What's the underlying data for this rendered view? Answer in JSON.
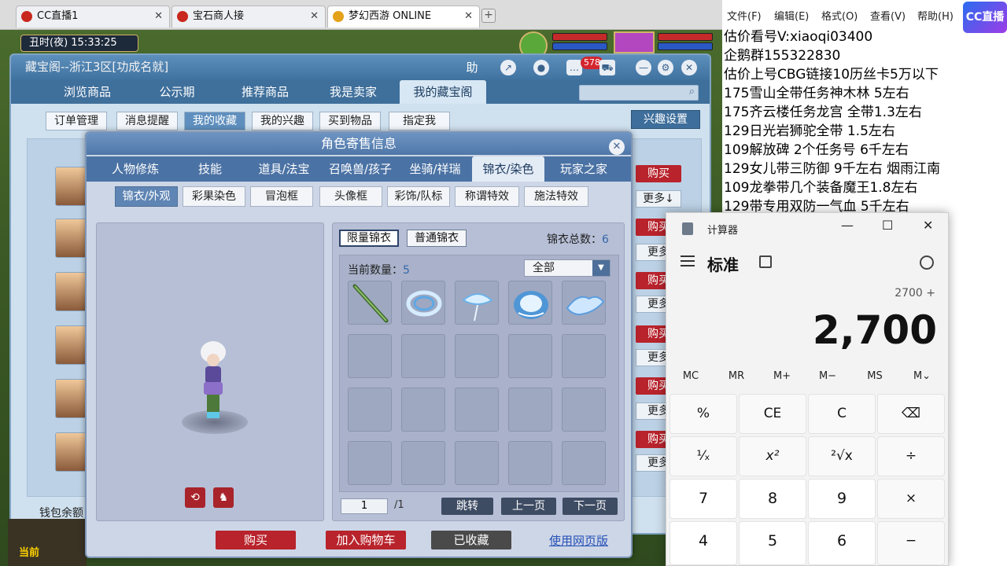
{
  "browser": {
    "tabs": [
      {
        "label": "CC直播1",
        "close": "✕"
      },
      {
        "label": "宝石商人接",
        "close": "✕"
      },
      {
        "label": "梦幻西游 ONLINE",
        "close": "✕"
      }
    ],
    "new_tab": "+"
  },
  "game_hud": {
    "time": "丑时(夜)  15:33:25",
    "bottom_label": "当前"
  },
  "cbg": {
    "title": "藏宝阁--浙江3区[功成名就]",
    "title_icons": {
      "help": "助",
      "badge": "578"
    },
    "nav": [
      "浏览商品",
      "公示期",
      "推荐商品",
      "我是卖家",
      "我的藏宝阁"
    ],
    "subnav": [
      "订单管理",
      "消息提醒",
      "我的收藏",
      "我的兴趣",
      "买到物品",
      "指定我"
    ],
    "interest_settings": "兴趣设置",
    "row_buy": "购买",
    "row_more": "更多",
    "row_more_arrow": "更多↓",
    "wallet": "钱包余额"
  },
  "dialog": {
    "title": "角色寄售信息",
    "close": "✕",
    "tabs": [
      "人物修炼",
      "技能",
      "道具/法宝",
      "召唤兽/孩子",
      "坐骑/祥瑞",
      "锦衣/染色",
      "玩家之家"
    ],
    "subtabs": [
      "锦衣/外观",
      "彩果染色",
      "冒泡框",
      "头像框",
      "彩饰/队标",
      "称谓特效",
      "施法特效"
    ],
    "wardrobe": {
      "tab_limited": "限量锦衣",
      "tab_normal": "普通锦衣",
      "total_label": "锦衣总数：",
      "total_value": "6",
      "current_label": "当前数量：",
      "current_value": "5",
      "filter": "全部",
      "page_current": "1",
      "page_total": "/1",
      "jump": "跳转",
      "prev": "上一页",
      "next": "下一页",
      "item_icons": [
        "staff-item-icon",
        "wave-ring-item-icon",
        "water-fan-item-icon",
        "water-shell-item-icon",
        "ice-wing-item-icon"
      ]
    },
    "preview_icons": {
      "rotate": "⟲",
      "pose": "♞"
    },
    "buttons": {
      "buy": "购买",
      "add_cart": "加入购物车",
      "favorited": "已收藏",
      "web": "使用网页版"
    }
  },
  "notepad": {
    "menu": [
      "文件(F)",
      "编辑(E)",
      "格式(O)",
      "查看(V)",
      "帮助(H)"
    ],
    "logo": "CC直播",
    "lines": [
      "估价看号V:xiaoqi03400",
      "企鹅群155322830",
      "估价上号CBG链接10历丝卡5万以下",
      "175雪山全带任务神木林 5左右",
      "175齐云楼任务龙宫  全带1.3左右",
      "129日光岩狮驼全带  1.5左右",
      "109解放碑 2个任务号 6千左右",
      "129女儿带三防御 9千左右 烟雨江南",
      "109龙拳带几个装备魔王1.8左右",
      "129带专用双防一气血 5千左右"
    ]
  },
  "calculator": {
    "title": "计算器",
    "mode": "标准",
    "expression": "2700 +",
    "result": "2,700",
    "window_controls": [
      "—",
      "☐",
      "✕"
    ],
    "memory": [
      "MC",
      "MR",
      "M+",
      "M−",
      "MS",
      "M⌄"
    ],
    "keys": [
      "%",
      "CE",
      "C",
      "⌫",
      "¹⁄ₓ",
      "x²",
      "²√x",
      "÷",
      "7",
      "8",
      "9",
      "×",
      "4",
      "5",
      "6",
      "−"
    ]
  },
  "colors": {
    "accent_red": "#b8232c",
    "nav_blue": "#3f6f9b",
    "link_blue": "#2651b8"
  }
}
